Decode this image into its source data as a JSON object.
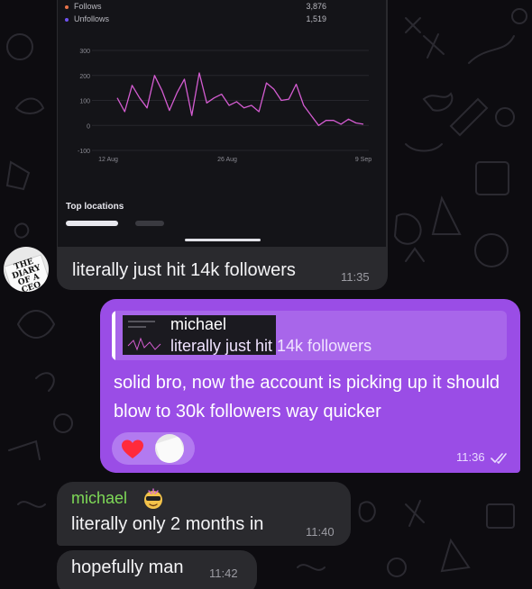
{
  "shared_screenshot": {
    "legend": [
      {
        "label": "Follows",
        "value": "3,876",
        "color": "#e8734a"
      },
      {
        "label": "Unfollows",
        "value": "1,519",
        "color": "#6f52f0"
      }
    ],
    "chart_data": {
      "type": "line",
      "x_tick_labels": [
        "12 Aug",
        "26 Aug",
        "9 Sep"
      ],
      "y_tick_labels": [
        "300",
        "200",
        "100",
        "0",
        "-100"
      ],
      "ylim": [
        -100,
        300
      ],
      "grid": true,
      "line_color": "#d45cd1",
      "series": [
        {
          "values": [
            110,
            55,
            160,
            110,
            70,
            200,
            140,
            60,
            130,
            185,
            40,
            210,
            90,
            110,
            125,
            80,
            95,
            70,
            80,
            55,
            170,
            145,
            100,
            105,
            165,
            80,
            40,
            0,
            20,
            20,
            5,
            25,
            10,
            5
          ]
        }
      ]
    },
    "top_locations_label": "Top locations"
  },
  "avatar_text": [
    "THE",
    "DIARY",
    "OF A",
    "CEO"
  ],
  "messages": [
    {
      "text": "literally just hit 14k followers",
      "time": "11:35"
    },
    {
      "reply_name": "michael",
      "reply_snippet": "literally just hit 14k followers",
      "text": "solid bro, now the account is picking up it should blow to 30k followers way quicker",
      "time": "11:36",
      "reactions": [
        "heart"
      ]
    },
    {
      "sender": "michael",
      "text": "literally only 2 months in",
      "time": "11:40"
    },
    {
      "text": "hopefully man",
      "time": "11:42"
    }
  ],
  "colors": {
    "background": "#0d0c10",
    "incoming_bubble": "#2a2a2e",
    "outgoing_bubble": "#9a4de6",
    "sender_name": "#7ed957"
  }
}
